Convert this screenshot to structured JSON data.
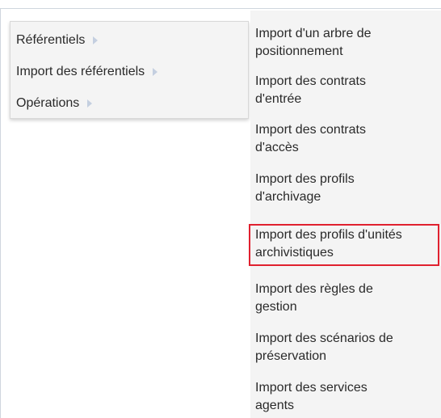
{
  "menu": {
    "items": [
      {
        "label": "Référentiels"
      },
      {
        "label": "Import des référentiels"
      },
      {
        "label": "Opérations"
      }
    ]
  },
  "submenu": {
    "items": [
      {
        "line1": "Import d'un arbre de",
        "line2": "positionnement"
      },
      {
        "line1": "Import des contrats",
        "line2": "d'entrée"
      },
      {
        "line1": "Import des contrats",
        "line2": "d'accès"
      },
      {
        "line1": "Import des profils",
        "line2": "d'archivage"
      },
      {
        "line1": "Import des profils d'unités",
        "line2": "archivistiques"
      },
      {
        "line1": "Import des règles de",
        "line2": "gestion"
      },
      {
        "line1": "Import des scénarios de",
        "line2": "préservation"
      },
      {
        "line1": "Import des services",
        "line2": "agents"
      }
    ],
    "highlighted_index": 4,
    "highlight_color": "#e0212f"
  }
}
